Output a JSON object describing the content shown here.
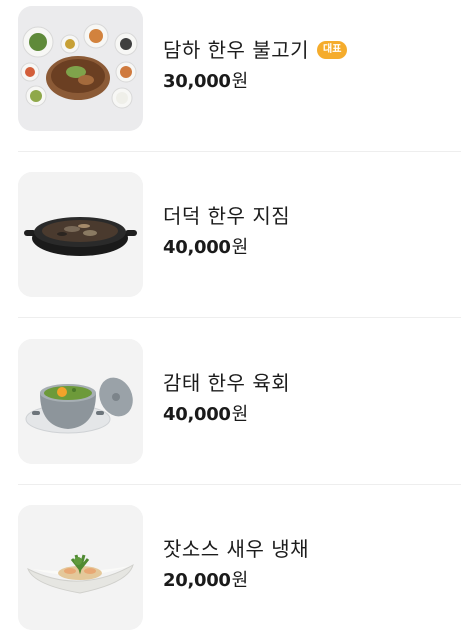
{
  "menu": {
    "items": [
      {
        "name": "담하 한우 불고기",
        "badge": "대표",
        "price": "30,000",
        "unit": "원",
        "icon": "bulgogi-table-photo"
      },
      {
        "name": "더덕 한우 지짐",
        "badge": "",
        "price": "40,000",
        "unit": "원",
        "icon": "jijim-pan-photo"
      },
      {
        "name": "감태 한우 육회",
        "badge": "",
        "price": "40,000",
        "unit": "원",
        "icon": "yukhoe-pot-photo"
      },
      {
        "name": "잣소스 새우 냉채",
        "badge": "",
        "price": "20,000",
        "unit": "원",
        "icon": "shrimp-salad-photo"
      }
    ]
  }
}
